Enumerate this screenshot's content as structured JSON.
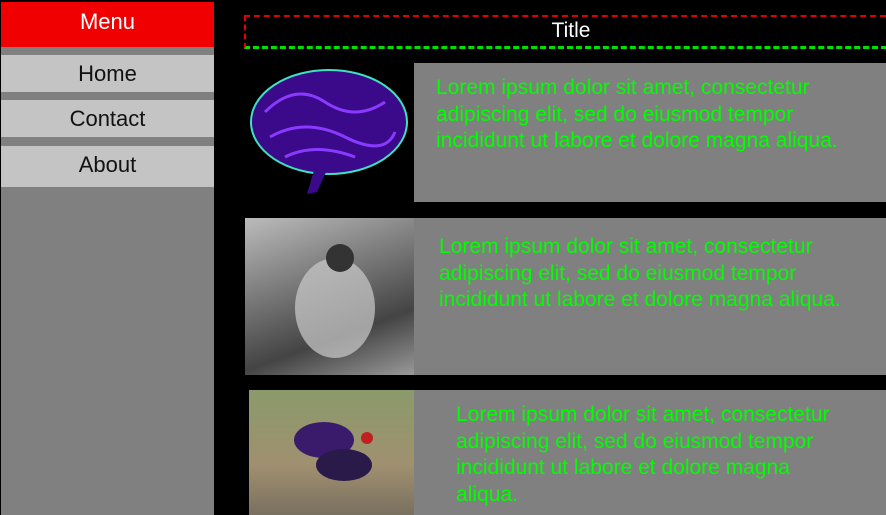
{
  "sidebar": {
    "menu_title": "Menu",
    "items": [
      {
        "label": "Home"
      },
      {
        "label": "Contact"
      },
      {
        "label": "About"
      }
    ],
    "header_color": "#f00000"
  },
  "header": {
    "title": "Title"
  },
  "rows": [
    {
      "image": "brain-image",
      "text": "Lorem ipsum dolor sit amet, consectetur adipiscing elit, sed do eiusmod tempor incididunt ut labore et dolore magna aliqua."
    },
    {
      "image": "vintage-photo-image",
      "text": "Lorem ipsum dolor sit amet, consectetur adipiscing elit, sed do eiusmod tempor incididunt ut labore et dolore magna aliqua."
    },
    {
      "image": "roosters-image",
      "text": "Lorem ipsum dolor sit amet, consectetur adipiscing elit, sed do eiusmod tempor incididunt ut labore et dolore magna aliqua."
    }
  ],
  "colors": {
    "text": "#00ff00",
    "panel": "#808080",
    "nav_item": "#c4c4c4"
  }
}
